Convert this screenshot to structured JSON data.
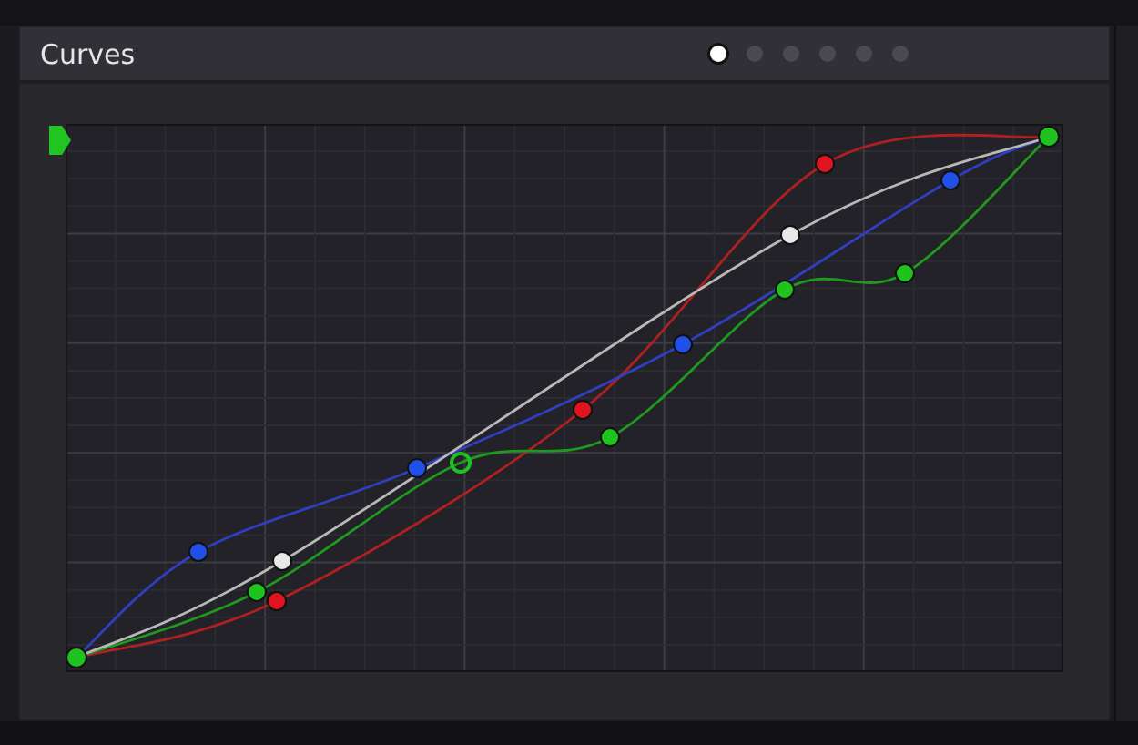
{
  "panel": {
    "title": "Curves",
    "page_dots": [
      {
        "selected": true
      },
      {
        "selected": false
      },
      {
        "selected": false
      },
      {
        "selected": false
      },
      {
        "selected": false
      },
      {
        "selected": false
      }
    ]
  }
}
